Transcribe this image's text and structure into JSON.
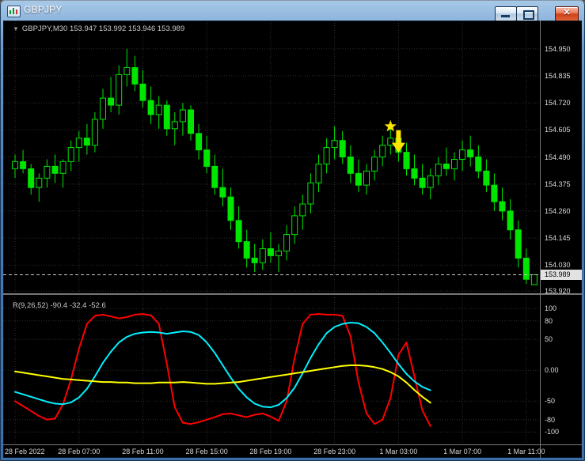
{
  "window": {
    "title": "GBPJPY",
    "close_glyph": "✕"
  },
  "chart_header": {
    "dropdown_glyph": "▼",
    "symbol": "GBPJPY,M30",
    "ohlc": "153.947 153.992 153.946 153.989"
  },
  "price_axis": {
    "ticks": [
      "154.950",
      "154.835",
      "154.720",
      "154.605",
      "154.490",
      "154.375",
      "154.260",
      "154.145",
      "154.030",
      "153.920"
    ],
    "current_price": "153.989"
  },
  "time_axis": {
    "labels": [
      "28 Feb 2022",
      "28 Feb 07:00",
      "28 Feb 11:00",
      "28 Feb 15:00",
      "28 Feb 19:00",
      "28 Feb 23:00",
      "1 Mar 03:00",
      "1 Mar 07:00",
      "1 Mar 11:00"
    ]
  },
  "indicator_pane": {
    "label": "R(9,26,52) -90.4 -32.4 -52.6",
    "ticks": [
      "100",
      "80",
      "50",
      "0.00",
      "-50",
      "-80",
      "-100"
    ]
  },
  "colors": {
    "background": "#000000",
    "candle": "#00E600",
    "grid": "#2E2E2E",
    "axis_text": "#DCDCDC",
    "price_line": "#C8C8C8",
    "marker": "#FFE600",
    "red": "#FF0000",
    "cyan": "#00F0FF",
    "yellow": "#FFFF00"
  },
  "chart_data": {
    "type": "candlestick",
    "symbol": "GBPJPY",
    "timeframe": "M30",
    "price_range": [
      153.91,
      155.07
    ],
    "price_ticks": [
      154.95,
      154.835,
      154.72,
      154.605,
      154.49,
      154.375,
      154.26,
      154.145,
      154.03,
      153.92
    ],
    "current_price": 153.989,
    "time_gridline_bars": [
      1,
      9,
      17,
      25,
      33,
      41,
      49,
      57,
      65
    ],
    "candles": [
      [
        154.44,
        154.5,
        154.4,
        154.47
      ],
      [
        154.47,
        154.52,
        154.42,
        154.44
      ],
      [
        154.44,
        154.46,
        154.33,
        154.36
      ],
      [
        154.36,
        154.42,
        154.3,
        154.4
      ],
      [
        154.4,
        154.48,
        154.36,
        154.45
      ],
      [
        154.45,
        154.5,
        154.38,
        154.42
      ],
      [
        154.42,
        154.48,
        154.36,
        154.47
      ],
      [
        154.47,
        154.56,
        154.43,
        154.53
      ],
      [
        154.53,
        154.6,
        154.47,
        154.57
      ],
      [
        154.57,
        154.63,
        154.5,
        154.54
      ],
      [
        154.54,
        154.68,
        154.51,
        154.65
      ],
      [
        154.65,
        154.78,
        154.61,
        154.74
      ],
      [
        154.74,
        154.83,
        154.68,
        154.71
      ],
      [
        154.71,
        154.88,
        154.67,
        154.84
      ],
      [
        154.84,
        154.95,
        154.79,
        154.87
      ],
      [
        154.87,
        154.92,
        154.77,
        154.8
      ],
      [
        154.8,
        154.86,
        154.7,
        154.73
      ],
      [
        154.73,
        154.79,
        154.63,
        154.67
      ],
      [
        154.67,
        154.75,
        154.61,
        154.71
      ],
      [
        154.71,
        154.73,
        154.58,
        154.61
      ],
      [
        154.61,
        154.68,
        154.54,
        154.64
      ],
      [
        154.64,
        154.72,
        154.58,
        154.69
      ],
      [
        154.69,
        154.71,
        154.56,
        154.59
      ],
      [
        154.59,
        154.63,
        154.48,
        154.52
      ],
      [
        154.52,
        154.58,
        154.42,
        154.45
      ],
      [
        154.45,
        154.5,
        154.33,
        154.36
      ],
      [
        154.36,
        154.44,
        154.28,
        154.32
      ],
      [
        154.32,
        154.36,
        154.18,
        154.22
      ],
      [
        154.22,
        154.28,
        154.1,
        154.13
      ],
      [
        154.13,
        154.18,
        154.02,
        154.06
      ],
      [
        154.06,
        154.12,
        154.0,
        154.04
      ],
      [
        154.04,
        154.14,
        154.01,
        154.1
      ],
      [
        154.1,
        154.17,
        154.04,
        154.07
      ],
      [
        154.07,
        154.12,
        154.0,
        154.09
      ],
      [
        154.09,
        154.2,
        154.05,
        154.16
      ],
      [
        154.16,
        154.28,
        154.12,
        154.24
      ],
      [
        154.24,
        154.33,
        154.18,
        154.29
      ],
      [
        154.29,
        154.42,
        154.25,
        154.38
      ],
      [
        154.38,
        154.5,
        154.34,
        154.46
      ],
      [
        154.46,
        154.57,
        154.42,
        154.53
      ],
      [
        154.53,
        154.62,
        154.48,
        154.56
      ],
      [
        154.56,
        154.6,
        154.46,
        154.49
      ],
      [
        154.49,
        154.54,
        154.38,
        154.42
      ],
      [
        154.42,
        154.48,
        154.34,
        154.37
      ],
      [
        154.37,
        154.46,
        154.33,
        154.43
      ],
      [
        154.43,
        154.52,
        154.39,
        154.49
      ],
      [
        154.49,
        154.58,
        154.45,
        154.54
      ],
      [
        154.54,
        154.62,
        154.5,
        154.57
      ],
      [
        154.57,
        154.6,
        154.47,
        154.51
      ],
      [
        154.51,
        154.55,
        154.41,
        154.44
      ],
      [
        154.44,
        154.5,
        154.37,
        154.4
      ],
      [
        154.4,
        154.46,
        154.33,
        154.36
      ],
      [
        154.36,
        154.44,
        154.31,
        154.41
      ],
      [
        154.41,
        154.49,
        154.37,
        154.46
      ],
      [
        154.46,
        154.53,
        154.41,
        154.44
      ],
      [
        154.44,
        154.51,
        154.39,
        154.48
      ],
      [
        154.48,
        154.56,
        154.43,
        154.52
      ],
      [
        154.52,
        154.58,
        154.45,
        154.49
      ],
      [
        154.49,
        154.54,
        154.4,
        154.43
      ],
      [
        154.43,
        154.48,
        154.34,
        154.37
      ],
      [
        154.37,
        154.42,
        154.26,
        154.3
      ],
      [
        154.3,
        154.36,
        154.22,
        154.26
      ],
      [
        154.26,
        154.31,
        154.14,
        154.18
      ],
      [
        154.18,
        154.22,
        154.02,
        154.06
      ],
      [
        154.06,
        154.1,
        153.95,
        153.97
      ],
      [
        153.947,
        153.992,
        153.946,
        153.989
      ]
    ],
    "markers": [
      {
        "type": "star",
        "bar": 48,
        "price": 154.62
      },
      {
        "type": "arrow-down",
        "bar": 49,
        "price": 154.51
      }
    ],
    "indicator": {
      "name": "R(9,26,52)",
      "last_values": [
        -90.4,
        -32.4,
        -52.6
      ],
      "range": [
        -120,
        118
      ],
      "ticks": [
        100,
        80,
        50,
        0,
        -50,
        -80,
        -100
      ],
      "series": [
        {
          "name": "fast",
          "color": "#FF0000",
          "values": [
            -50,
            -58,
            -66,
            -74,
            -80,
            -78,
            -55,
            -15,
            35,
            75,
            88,
            90,
            87,
            84,
            86,
            90,
            91,
            89,
            75,
            10,
            -60,
            -85,
            -87,
            -84,
            -80,
            -76,
            -71,
            -70,
            -73,
            -76,
            -72,
            -70,
            -75,
            -82,
            -50,
            20,
            75,
            90,
            91,
            90,
            90,
            88,
            55,
            -20,
            -70,
            -87,
            -80,
            -45,
            25,
            45,
            -10,
            -65,
            -90.4
          ]
        },
        {
          "name": "medium",
          "color": "#00F0FF",
          "values": [
            -35,
            -39,
            -43,
            -47,
            -51,
            -54,
            -55,
            -52,
            -44,
            -30,
            -10,
            12,
            30,
            45,
            54,
            59,
            61,
            62,
            61,
            59,
            61,
            63,
            62,
            57,
            45,
            28,
            8,
            -12,
            -30,
            -44,
            -54,
            -59,
            -60,
            -56,
            -45,
            -28,
            -5,
            20,
            42,
            60,
            70,
            75,
            77,
            76,
            70,
            60,
            45,
            28,
            10,
            -6,
            -18,
            -27,
            -32.4
          ]
        },
        {
          "name": "slow",
          "color": "#FFFF00",
          "values": [
            -2,
            -4,
            -6,
            -8,
            -10,
            -12,
            -14,
            -15,
            -16,
            -17,
            -18,
            -19,
            -19,
            -20,
            -20,
            -21,
            -21,
            -21,
            -20,
            -20,
            -20,
            -19,
            -20,
            -21,
            -22,
            -22,
            -21,
            -20,
            -19,
            -17,
            -15,
            -13,
            -11,
            -9,
            -7,
            -5,
            -3,
            -1,
            1,
            3,
            5,
            7,
            8,
            8,
            7,
            5,
            2,
            -3,
            -10,
            -20,
            -32,
            -43,
            -52.6
          ]
        }
      ]
    }
  }
}
